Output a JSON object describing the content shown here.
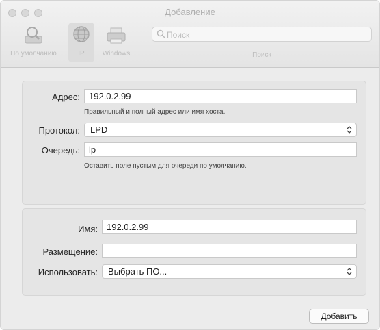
{
  "window": {
    "title": "Добавление"
  },
  "toolbar": {
    "tabs": [
      {
        "label": "По умолчанию",
        "icon": "magnifier-printer-icon"
      },
      {
        "label": "IP",
        "icon": "globe-icon"
      },
      {
        "label": "Windows",
        "icon": "printer-icon"
      }
    ],
    "active_tab": "IP",
    "search": {
      "placeholder": "Поиск",
      "label": "Поиск"
    }
  },
  "connection": {
    "address": {
      "label": "Адрес:",
      "value": "192.0.2.99",
      "hint": "Правильный и полный адрес или имя хоста."
    },
    "protocol": {
      "label": "Протокол:",
      "value": "LPD"
    },
    "queue": {
      "label": "Очередь:",
      "value": "lp",
      "hint": "Оставить поле пустым для очереди по умолчанию."
    }
  },
  "printer": {
    "name": {
      "label": "Имя:",
      "value": "192.0.2.99"
    },
    "location": {
      "label": "Размещение:",
      "value": ""
    },
    "use": {
      "label": "Использовать:",
      "value": "Выбрать ПО..."
    }
  },
  "actions": {
    "add_label": "Добавить"
  }
}
